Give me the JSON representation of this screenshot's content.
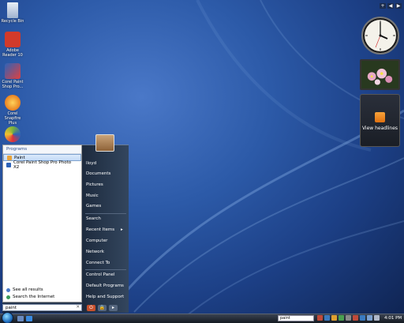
{
  "desktop": {
    "icons": [
      {
        "label": "Recycle Bin",
        "color": "#c9d6e8"
      },
      {
        "label": "Adobe Reader 10",
        "color": "#d23a2a"
      },
      {
        "label": "Corel Paint Shop Pro...",
        "color": "#2e63b8"
      },
      {
        "label": "Corel Snapfire Plus",
        "color": "#f08a1a"
      },
      {
        "label": "",
        "color": "#7bb43a"
      }
    ]
  },
  "sidebar": {
    "controls": [
      "+",
      "◀",
      "▶"
    ],
    "feed_label": "View headlines"
  },
  "start_menu": {
    "programs_header": "Programs",
    "results": [
      {
        "label": "Paint",
        "icon": "paint-icon",
        "selected": true,
        "color": "#e7a33b"
      },
      {
        "label": "Corel Paint Shop Pro Photo X2",
        "icon": "paintshop-icon",
        "selected": false,
        "color": "#2e63b8"
      }
    ],
    "see_all": "See all results",
    "search_internet": "Search the Internet",
    "search_value": "paint",
    "right_pane": {
      "items": [
        "lloyd",
        "Documents",
        "Pictures",
        "Music",
        "Games",
        "Search",
        "Recent Items",
        "Computer",
        "Network",
        "Connect To",
        "Control Panel",
        "Default Programs",
        "Help and Support"
      ]
    }
  },
  "taskbar": {
    "search_value": "paint",
    "time": "4:01 PM"
  }
}
